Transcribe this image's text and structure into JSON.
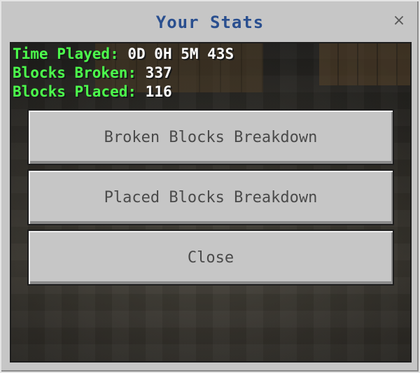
{
  "dialog": {
    "title": "Your Stats",
    "close_glyph": "×"
  },
  "stats": [
    {
      "label": "Time Played:",
      "value": "0D 0H 5M 43S"
    },
    {
      "label": "Blocks Broken:",
      "value": "337"
    },
    {
      "label": "Blocks Placed:",
      "value": "116"
    }
  ],
  "buttons": {
    "broken_label": "Broken Blocks Breakdown",
    "placed_label": "Placed Blocks Breakdown",
    "close_label": "Close"
  },
  "colors": {
    "title": "#2a4f8f",
    "stat_label": "#4cff4c",
    "stat_value": "#ffffff",
    "panel": "#c6c6c6",
    "button_text": "#4a4a4a"
  },
  "icons": {
    "close": "close-icon"
  }
}
